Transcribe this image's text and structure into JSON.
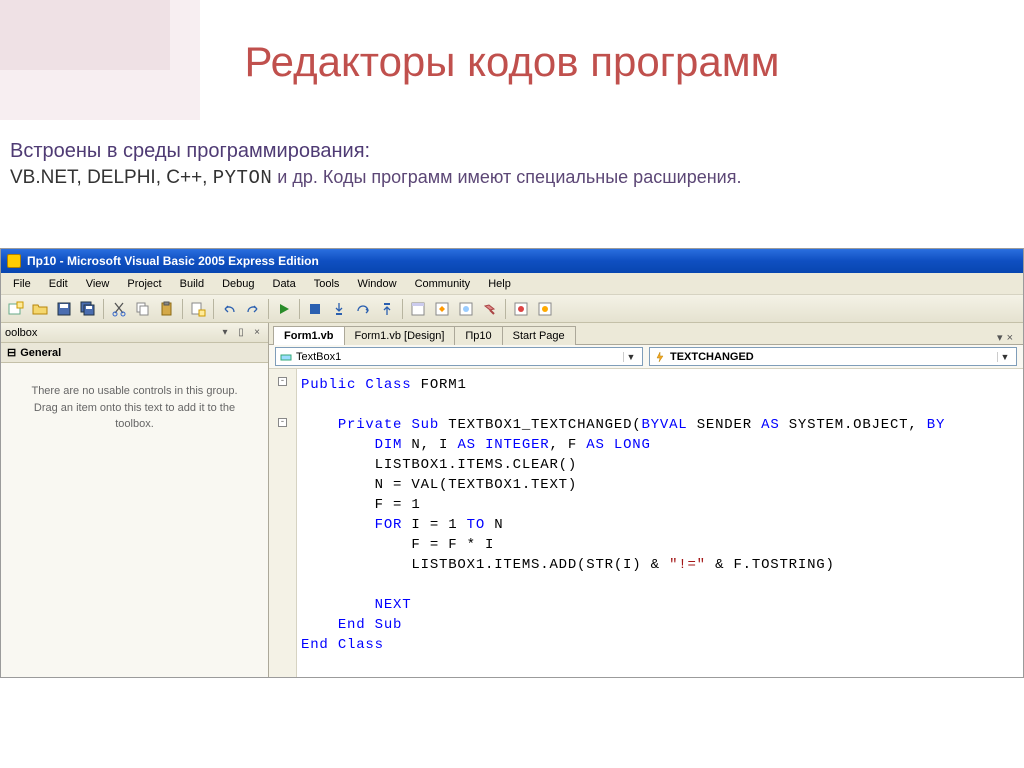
{
  "slide": {
    "title": "Редакторы кодов программ",
    "line1": "Встроены в  среды программирования:",
    "line2_langs": "VB.NET, DELPHI, C++, ",
    "line2_pyton": "PYTON",
    "line2_rest": " и др. Коды программ имеют специальные расширения."
  },
  "ide": {
    "title": "Пр10 - Microsoft Visual Basic 2005 Express Edition",
    "menus": [
      "File",
      "Edit",
      "View",
      "Project",
      "Build",
      "Debug",
      "Data",
      "Tools",
      "Window",
      "Community",
      "Help"
    ],
    "toolbox": {
      "pane_title": "oolbox",
      "section": "General",
      "empty_text": "There are no usable controls in this group. Drag an item onto this text to add it to the toolbox."
    },
    "tabs": [
      {
        "label": "Form1.vb",
        "active": true
      },
      {
        "label": "Form1.vb [Design]",
        "active": false
      },
      {
        "label": "Пр10",
        "active": false
      },
      {
        "label": "Start Page",
        "active": false
      }
    ],
    "members": {
      "left": {
        "icon": "field",
        "label": "TextBox1"
      },
      "right": {
        "icon": "event",
        "label": "TEXTCHANGED"
      }
    },
    "code": {
      "l1_kw1": "Public",
      "l1_kw2": "Class",
      "l1_name": " FORM1",
      "l3_kw1": "Private",
      "l3_kw2": "Sub",
      "l3_name": " TEXTBOX1_TEXTCHANGED(",
      "l3_kw3": "BYVAL",
      "l3_t1": " SENDER ",
      "l3_kw4": "AS",
      "l3_t2": " SYSTEM.OBJECT, ",
      "l3_kw5": "BY",
      "l4_kw1": "DIM",
      "l4_t1": " N, I ",
      "l4_kw2": "AS",
      "l4_kw3": "INTEGER",
      "l4_t2": ", F ",
      "l4_kw4": "AS",
      "l4_kw5": "LONG",
      "l5": "LISTBOX1.ITEMS.CLEAR()",
      "l6": "N = VAL(TEXTBOX1.TEXT)",
      "l7": "F = 1",
      "l8_kw1": "FOR",
      "l8_t1": " I = 1 ",
      "l8_kw2": "TO",
      "l8_t2": " N",
      "l9": "F = F * I",
      "l10_t1": "LISTBOX1.ITEMS.ADD(STR(I) & ",
      "l10_str": "\"!=\"",
      "l10_t2": " & F.TOSTRING)",
      "l12_kw": "NEXT",
      "l13_kw1": "End",
      "l13_kw2": "Sub",
      "l14_kw1": "End",
      "l14_kw2": "Class"
    }
  }
}
